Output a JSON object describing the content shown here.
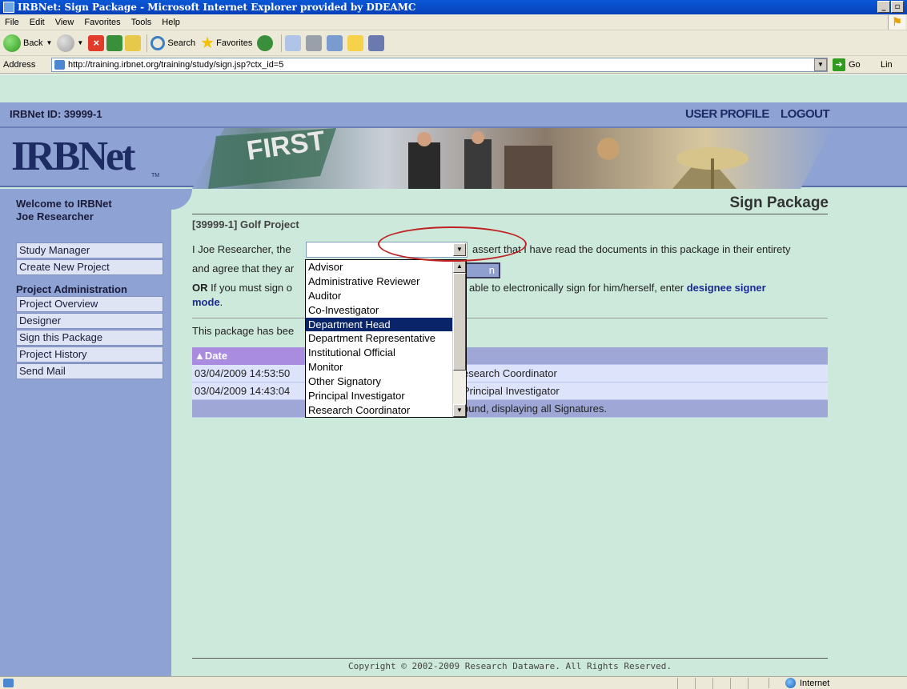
{
  "window": {
    "title": "IRBNet: Sign Package - Microsoft Internet Explorer provided by DDEAMC"
  },
  "menu": [
    "File",
    "Edit",
    "View",
    "Favorites",
    "Tools",
    "Help"
  ],
  "toolbar": {
    "back": "Back",
    "search": "Search",
    "favorites": "Favorites"
  },
  "address": {
    "label": "Address",
    "url": "http://training.irbnet.org/training/study/sign.jsp?ctx_id=5",
    "go": "Go",
    "links": "Lin"
  },
  "header": {
    "irbnet_id": "IRBNet ID: 39999-1",
    "user_profile": "USER PROFILE",
    "logout": "LOGOUT",
    "logo": "IRBNet",
    "logo_tm": "TM"
  },
  "sidebar": {
    "welcome_line1": "Welcome to IRBNet",
    "welcome_line2": "Joe Researcher",
    "top_items": [
      "Study Manager",
      "Create New Project"
    ],
    "section_heading": "Project Administration",
    "admin_items": [
      "Project Overview",
      "Designer",
      "Sign this Package",
      "Project History",
      "Send Mail"
    ]
  },
  "main": {
    "page_title": "Sign Package",
    "project_name": "[39999-1] Golf Project",
    "sign_line1_prefix": "I Joe Researcher, the",
    "sign_line1_suffix": "assert that I have read the documents in this package in their entirety",
    "sign_line2": "and agree that they ar",
    "sign_button_label": "n",
    "or_label": "OR",
    "or_text_start": "If you must sign o",
    "or_text_end": "able to electronically sign for him/herself, enter",
    "designee_link_a": "designee signer",
    "designee_link_b": "mode",
    "period": ".",
    "package_status": "This package has bee",
    "role_dropdown": {
      "value": "",
      "options": [
        "Advisor",
        "Administrative Reviewer",
        "Auditor",
        "Co-Investigator",
        "Department Head",
        "Department Representative",
        "Institutional Official",
        "Monitor",
        "Other Signatory",
        "Principal Investigator",
        "Research Coordinator"
      ],
      "selected": "Department Head"
    },
    "table": {
      "header_date": "Date",
      "rows": [
        {
          "date": "03/04/2009 14:53:50",
          "role": "esearch Coordinator"
        },
        {
          "date": "03/04/2009 14:43:04",
          "role": "Principal Investigator"
        }
      ],
      "footer": "bund, displaying all Signatures."
    },
    "copyright": "Copyright © 2002-2009 Research Dataware. All Rights Reserved."
  },
  "status": {
    "zone": "Internet"
  },
  "colors": {
    "sidebar": "#8ea3d3",
    "content": "#cce9dc",
    "selected_option": "#0a246a",
    "annotation": "#c02020"
  }
}
